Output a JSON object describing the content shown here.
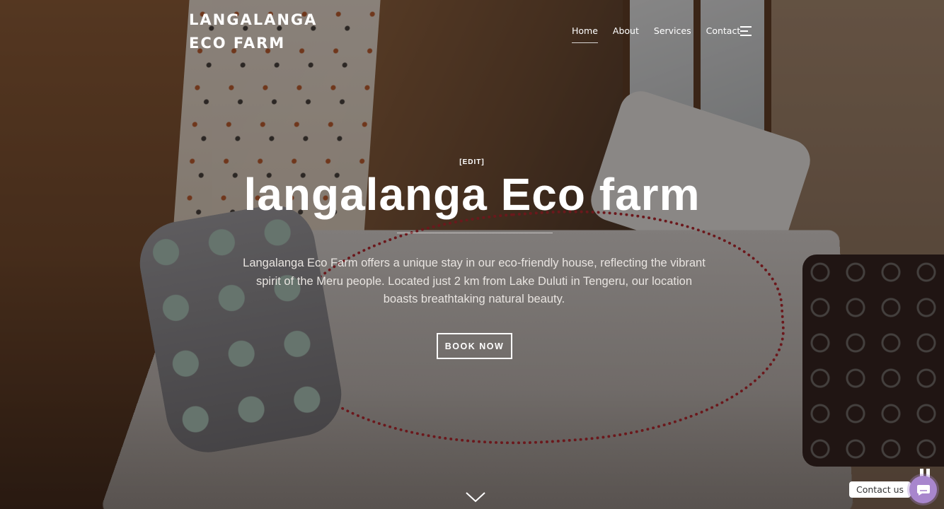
{
  "site": {
    "logo_text": "LANGALANGA ECO FARM"
  },
  "nav": {
    "items": [
      {
        "label": "Home",
        "active": true
      },
      {
        "label": "About",
        "active": false
      },
      {
        "label": "Services",
        "active": false
      },
      {
        "label": "Contact",
        "active": false
      }
    ],
    "menu_icon": "hamburger-icon"
  },
  "hero": {
    "edit_label": "[EDIT]",
    "title": "langalanga Eco farm",
    "description": "Langalanga Eco Farm offers a unique stay in our eco-friendly house, reflecting the vibrant spirit of the Meru people. Located just 2 km from Lake Duluti in Tengeru, our location boasts breathtaking natural beauty.",
    "cta_label": "BOOK NOW",
    "scroll_icon": "chevron-down-icon"
  },
  "widgets": {
    "pause_icon": "pause-icon",
    "contact_label": "Contact us",
    "chat_icon": "chat-icon",
    "chat_color": "#a886cd"
  }
}
